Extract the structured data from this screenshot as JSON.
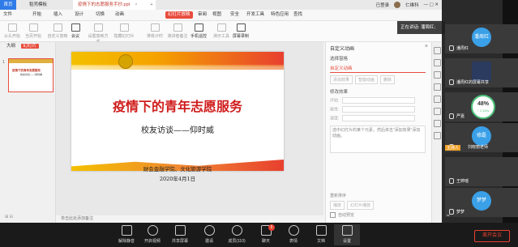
{
  "tabs": {
    "home": "首页",
    "template": "稻壳模板",
    "doc": "疫情下的志愿服务手抄.ppt",
    "add": "+"
  },
  "titlebar": {
    "login": "已登录",
    "user": "仁维科"
  },
  "menu": [
    "文件",
    "开始",
    "插入",
    "设计",
    "切换",
    "动画",
    "幻灯片放映",
    "审阅",
    "视图",
    "安全",
    "开发工具",
    "特色应用",
    "查找"
  ],
  "menu_active_index": 6,
  "toolbar": [
    "从头开始",
    "当页开始",
    "自定义放映",
    "会议",
    "设置放映方式",
    "隐藏幻灯片",
    "排练计时",
    "演讲者备注",
    "手机遥控",
    "演示工具",
    "屏幕录制"
  ],
  "toolbar_dark": [
    3,
    8,
    10
  ],
  "left_panel": {
    "tab1": "大纲",
    "tab2": "幻灯片",
    "slide_num": "1",
    "bottom": "⊞ ⊟"
  },
  "slide": {
    "title": "疫情下的青年志愿服务",
    "subtitle": "校友访谈——仰时威",
    "org": "财会金融学院、文化旅游学院",
    "date": "2020年4月1日",
    "thumb_title": "疫情下的青年志愿服务",
    "thumb_sub": "校友访谈——仰时威"
  },
  "notes": "单击此处添加备注",
  "anim_panel": {
    "header": "自定义动画",
    "close": "×",
    "select": "选择窗格",
    "title": "自定义动画",
    "btn_add": "添加效果",
    "btn_smart": "智能动画",
    "btn_del": "删除",
    "section": "修改效果",
    "f1": "开始:",
    "f2": "属性:",
    "f3": "速度:",
    "desc": "选中幻灯片的某个元素，然后单击“添加效果”添加动画。",
    "order": "重新排序",
    "play": "播放",
    "show": "幻灯片播放",
    "check": "自动预览"
  },
  "zoom": {
    "speaking": "正在讲话: 潘周红;",
    "participants": [
      {
        "name": "潘周红",
        "avatar": "潘周红",
        "color": "#3aa0e8",
        "type": "avatar"
      },
      {
        "name": "潘周红的屏幕共享",
        "avatar": "",
        "color": "#2b3b60",
        "type": "share"
      },
      {
        "name": "严嘉",
        "avatar": "",
        "color": "#4a4a4a",
        "type": "gauge"
      },
      {
        "name": "刘晓丽老师",
        "avatar": "修磊",
        "color": "#3aa0e8",
        "type": "speaker"
      },
      {
        "name": "王婷瑶",
        "avatar": "",
        "color": "#3a3a3a",
        "type": "plain"
      },
      {
        "name": "梦梦",
        "avatar": "梦梦",
        "color": "#3aa0e8",
        "type": "avatar"
      }
    ],
    "gauge": {
      "value": "48%",
      "rate": "↑ 1.1K/s"
    },
    "speaker_badge": "主持人",
    "controls": [
      "解除静音",
      "开启视频",
      "共享屏幕",
      "邀请",
      "成员(110)",
      "聊天",
      "表情",
      "文档",
      "设置"
    ],
    "chat_badge": "5",
    "leave": "离开会议",
    "more": "⌄"
  }
}
